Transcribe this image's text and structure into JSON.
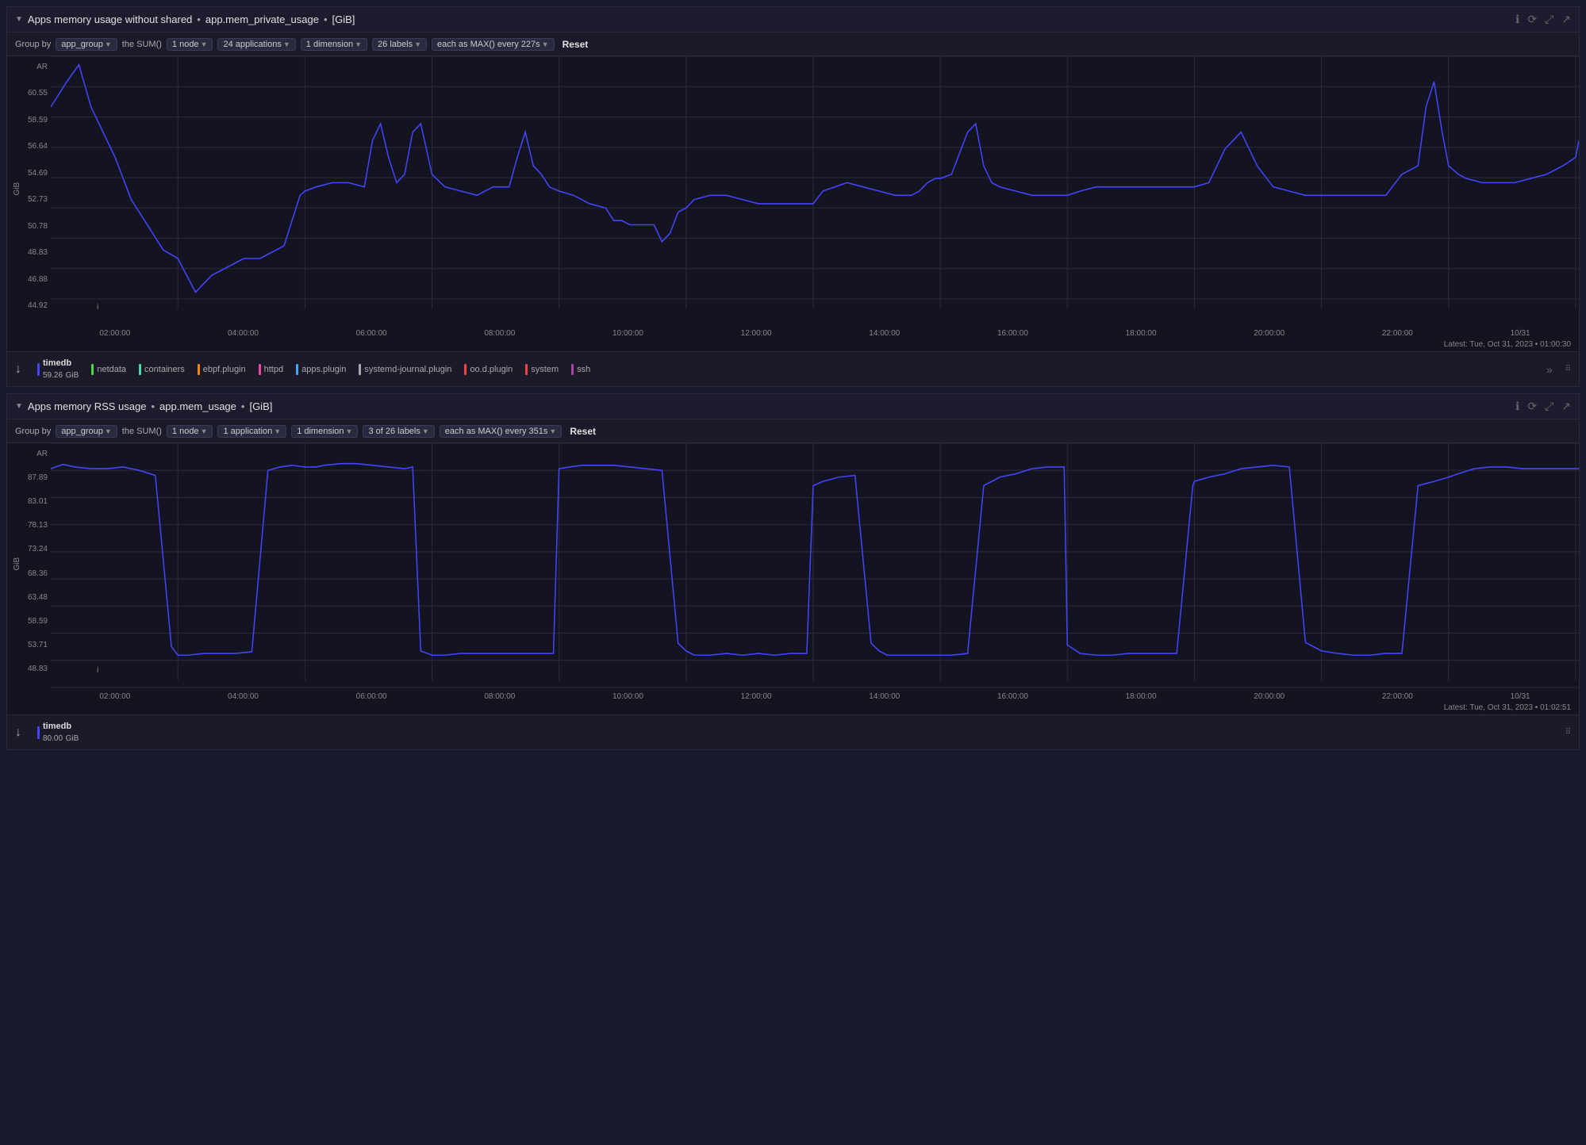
{
  "panel1": {
    "title": "Apps memory usage without shared",
    "metric": "app.mem_private_usage",
    "unit": "[GiB]",
    "icons": [
      "info",
      "sync",
      "expand",
      "share"
    ],
    "controls": {
      "group_by_label": "Group by",
      "group_by_value": "app_group",
      "sum_label": "the SUM()",
      "nodes": "1 node",
      "applications": "24 applications",
      "dimension": "1 dimension",
      "labels": "26 labels",
      "each_as": "each as MAX() every 227s",
      "reset": "Reset"
    },
    "y_axis": {
      "label": "GiB",
      "values": [
        "60.55",
        "58.59",
        "56.64",
        "54.69",
        "52.73",
        "50.78",
        "48.83",
        "46.88",
        "44.92"
      ]
    },
    "x_axis": [
      "02:00:00",
      "04:00:00",
      "06:00:00",
      "08:00:00",
      "10:00:00",
      "12:00:00",
      "14:00:00",
      "16:00:00",
      "18:00:00",
      "20:00:00",
      "22:00:00",
      "10/31"
    ],
    "y_top_label": "AR",
    "i_label": "i",
    "timestamp": "Latest: Tue, Oct 31, 2023 • 01:00:30",
    "legend": {
      "main_name": "timedb",
      "main_value": "59.26",
      "main_unit": "GiB",
      "main_color": "#4444ff",
      "others": [
        {
          "name": "netdata",
          "color": "#44dd44"
        },
        {
          "name": "containers",
          "color": "#44ddaa"
        },
        {
          "name": "ebpf.plugin",
          "color": "#ee8800"
        },
        {
          "name": "httpd",
          "color": "#ee44aa"
        },
        {
          "name": "apps.plugin",
          "color": "#44aaee"
        },
        {
          "name": "systemd-journal.plugin",
          "color": "#aaaaaa"
        },
        {
          "name": "oo.d.plugin",
          "color": "#ee4444"
        },
        {
          "name": "system",
          "color": "#ee4444"
        },
        {
          "name": "ssh",
          "color": "#aa44aa"
        }
      ]
    }
  },
  "panel2": {
    "title": "Apps memory RSS usage",
    "metric": "app.mem_usage",
    "unit": "[GiB]",
    "icons": [
      "info",
      "sync",
      "expand",
      "share"
    ],
    "controls": {
      "group_by_label": "Group by",
      "group_by_value": "app_group",
      "sum_label": "the SUM()",
      "nodes": "1 node",
      "applications": "1 application",
      "dimension": "1 dimension",
      "labels": "3 of 26 labels",
      "each_as": "each as MAX() every 351s",
      "reset": "Reset"
    },
    "y_axis": {
      "label": "GiB",
      "values": [
        "87.89",
        "83.01",
        "78.13",
        "73.24",
        "68.36",
        "63.48",
        "58.59",
        "53.71",
        "48.83"
      ]
    },
    "x_axis": [
      "02:00:00",
      "04:00:00",
      "06:00:00",
      "08:00:00",
      "10:00:00",
      "12:00:00",
      "14:00:00",
      "16:00:00",
      "18:00:00",
      "20:00:00",
      "22:00:00",
      "10/31"
    ],
    "y_top_label": "AR",
    "i_label": "i",
    "timestamp": "Latest: Tue, Oct 31, 2023 • 01:02:51",
    "legend": {
      "main_name": "timedb",
      "main_value": "80.00",
      "main_unit": "GiB",
      "main_color": "#4444ff"
    }
  }
}
